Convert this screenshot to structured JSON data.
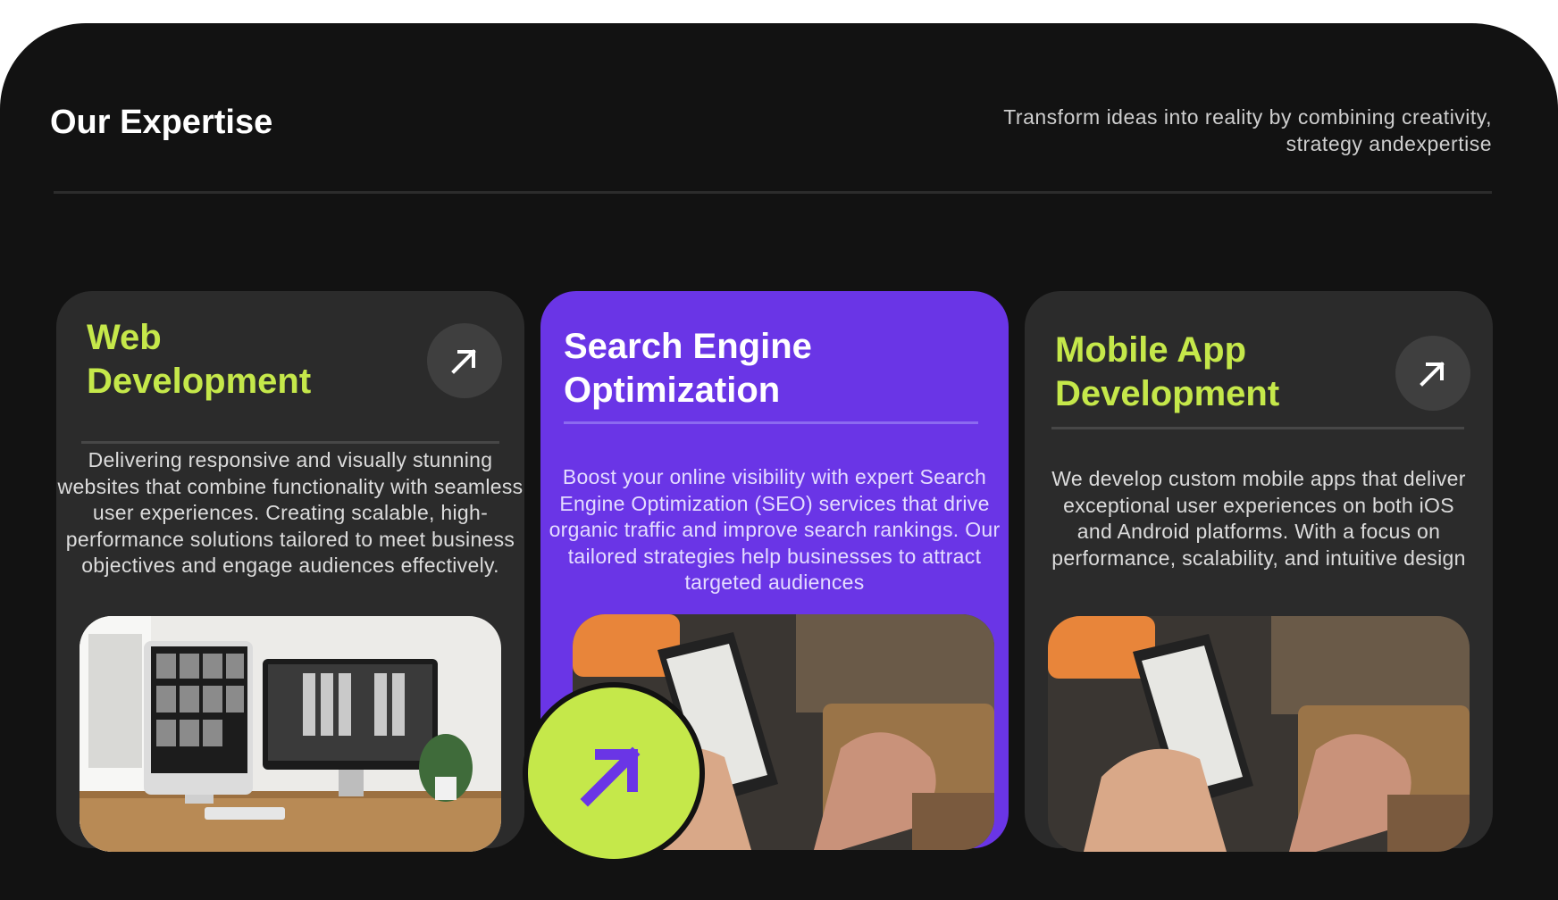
{
  "header": {
    "title": "Our Expertise",
    "subtitle": "Transform ideas into reality by combining creativity, strategy andexpertise"
  },
  "cards": [
    {
      "title": "Web Development",
      "description": "Delivering responsive and visually stunning websites that combine functionality with seamless user experiences. Creating scalable, high-performance solutions tailored to meet business objectives and engage audiences effectively.",
      "image": "desk-with-monitors-photo",
      "icon": "arrow-up-right-icon"
    },
    {
      "title": "Search Engine Optimization",
      "description": "Boost your online visibility with expert Search Engine Optimization (SEO) services that drive organic traffic and improve search rankings. Our tailored strategies help businesses to attract targeted audiences",
      "image": "hand-holding-phone-photo",
      "icon": "arrow-up-right-icon"
    },
    {
      "title": "Mobile App Development",
      "description": "We develop custom mobile apps that deliver exceptional user experiences on both iOS and Android platforms. With a focus on performance, scalability, and intuitive design",
      "image": "hand-holding-phone-photo",
      "icon": "arrow-up-right-icon"
    }
  ],
  "colors": {
    "background": "#121212",
    "card": "#2b2b2b",
    "accent_purple": "#6a35e6",
    "accent_lime": "#c5e84a"
  }
}
